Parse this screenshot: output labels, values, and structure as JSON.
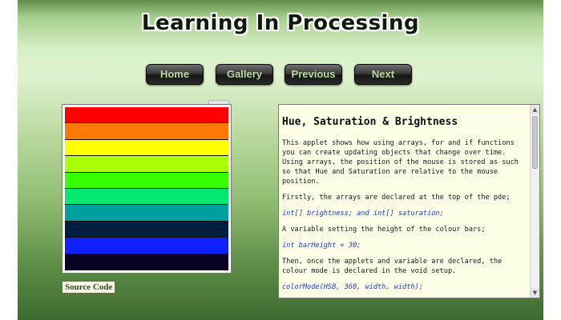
{
  "site": {
    "title": "Learning In Processing"
  },
  "nav": {
    "items": [
      {
        "label": "Home"
      },
      {
        "label": "Gallery"
      },
      {
        "label": "Previous"
      },
      {
        "label": "Next"
      }
    ]
  },
  "applet": {
    "bar_colors": [
      "#ff0000",
      "#ff7a00",
      "#ffff00",
      "#aaff00",
      "#38ff00",
      "#00e870",
      "#00a0a0",
      "#001f3f",
      "#1020ff",
      "#0a0022"
    ]
  },
  "source": {
    "label": "Source Code"
  },
  "article": {
    "title": "Hue, Saturation & Brightness",
    "paragraphs": [
      {
        "text": "This applet shows how using arrays, for and if functions you can create updating objects that change over time. Using arrays, the position of the mouse is stored as such so that Hue and Saturation are relative to the mouse position.",
        "code": false
      },
      {
        "text": "Firstly, the arrays are declared at the top of the pde;",
        "code": false
      },
      {
        "text": "int[] brightness; and int[] saturation;",
        "code": true
      },
      {
        "text": "A variable setting the height of the colour bars;",
        "code": false
      },
      {
        "text": "int barHeight = 30;",
        "code": true
      },
      {
        "text": "Then, once the applets and variable are declared, the colour mode is declared in the void setup.",
        "code": false
      },
      {
        "text": "colorMode(HSB, 360, width, width);",
        "code": true
      }
    ]
  }
}
